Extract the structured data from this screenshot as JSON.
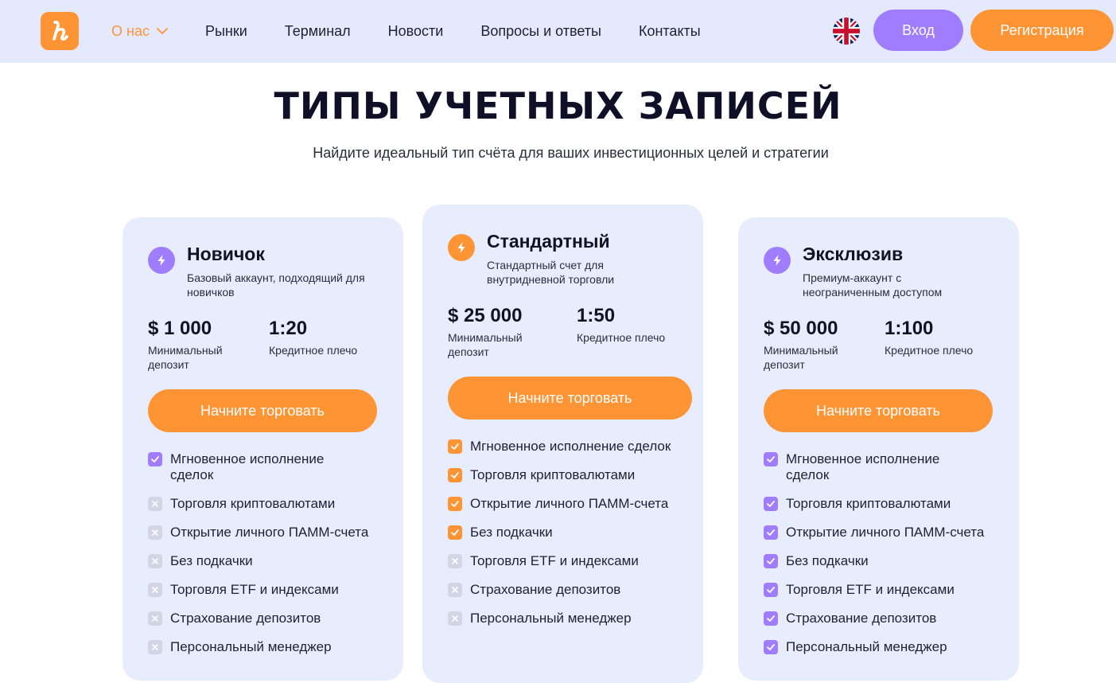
{
  "header": {
    "nav": [
      {
        "label": "О нас",
        "active": true,
        "dropdown": true
      },
      {
        "label": "Рынки"
      },
      {
        "label": "Терминал"
      },
      {
        "label": "Новости"
      },
      {
        "label": "Вопросы и ответы"
      },
      {
        "label": "Контакты"
      }
    ],
    "language_icon": "uk-flag-icon",
    "login_label": "Вход",
    "register_label": "Регистрация"
  },
  "hero": {
    "title": "ТИПЫ УЧЕТНЫХ ЗАПИСЕЙ",
    "subtitle": "Найдите идеальный тип счёта для ваших инвестиционных целей и стратегии"
  },
  "colors": {
    "accent_orange": "#ff9434",
    "accent_purple": "#a07dff",
    "card_bg": "#e8edfd",
    "header_bg": "#e4e9fd"
  },
  "plans": [
    {
      "name": "Новичок",
      "description": "Базовый аккаунт, подходящий для новичков",
      "icon": "lightning-icon",
      "accent": "purple",
      "deposit": "$ 1 000",
      "deposit_label": "Минимальный депозит",
      "leverage": "1:20",
      "leverage_label": "Кредитное плечо",
      "cta": "Начните торговать",
      "features": [
        {
          "label": "Мгновенное исполнение сделок",
          "included": true
        },
        {
          "label": "Торговля криптовалютами",
          "included": false
        },
        {
          "label": "Открытие личного ПАММ-счета",
          "included": false
        },
        {
          "label": "Без подкачки",
          "included": false
        },
        {
          "label": "Торговля ETF и индексами",
          "included": false
        },
        {
          "label": "Страхование депозитов",
          "included": false
        },
        {
          "label": "Персональный менеджер",
          "included": false
        }
      ]
    },
    {
      "name": "Стандартный",
      "description": "Стандартный счет для внутридневной торговли",
      "icon": "lightning-icon",
      "accent": "orange",
      "deposit": "$ 25 000",
      "deposit_label": "Минимальный депозит",
      "leverage": "1:50",
      "leverage_label": "Кредитное плечо",
      "cta": "Начните торговать",
      "features": [
        {
          "label": "Мгновенное исполнение сделок",
          "included": true
        },
        {
          "label": "Торговля криптовалютами",
          "included": true
        },
        {
          "label": "Открытие личного ПАММ-счета",
          "included": true
        },
        {
          "label": "Без подкачки",
          "included": true
        },
        {
          "label": "Торговля ETF и индексами",
          "included": false
        },
        {
          "label": "Страхование депозитов",
          "included": false
        },
        {
          "label": "Персональный менеджер",
          "included": false
        }
      ]
    },
    {
      "name": "Эксклюзив",
      "description": "Премиум-аккаунт с неограниченным доступом",
      "icon": "lightning-icon",
      "accent": "purple",
      "deposit": "$ 50 000",
      "deposit_label": "Минимальный депозит",
      "leverage": "1:100",
      "leverage_label": "Кредитное плечо",
      "cta": "Начните торговать",
      "features": [
        {
          "label": "Мгновенное исполнение сделок",
          "included": true
        },
        {
          "label": "Торговля криптовалютами",
          "included": true
        },
        {
          "label": "Открытие личного ПАММ-счета",
          "included": true
        },
        {
          "label": "Без подкачки",
          "included": true
        },
        {
          "label": "Торговля ETF и индексами",
          "included": true
        },
        {
          "label": "Страхование депозитов",
          "included": true
        },
        {
          "label": "Персональный менеджер",
          "included": true
        }
      ]
    }
  ]
}
